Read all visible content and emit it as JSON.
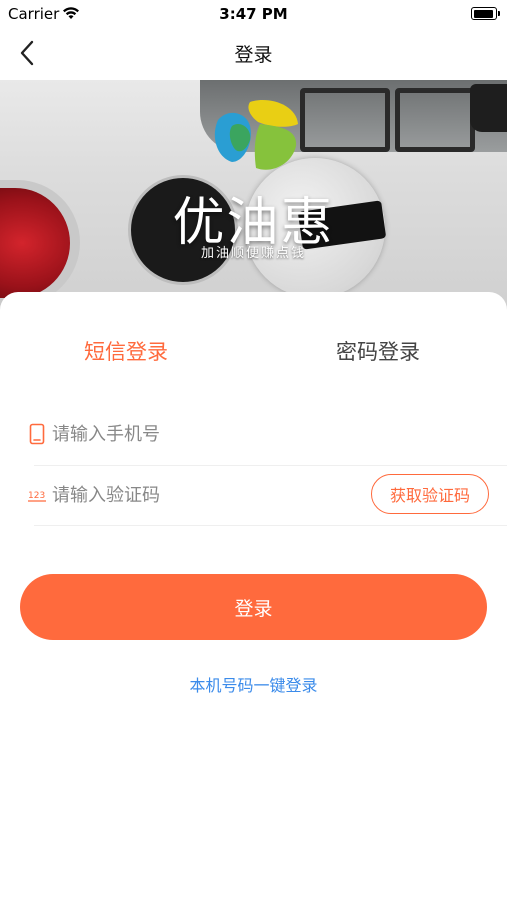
{
  "status_bar": {
    "carrier": "Carrier",
    "time": "3:47 PM"
  },
  "nav": {
    "title": "登录",
    "back_icon": "chevron-left-icon"
  },
  "banner": {
    "brand_name": "优油惠",
    "slogan": "加油顺便赚点钱",
    "logo_colors": [
      "#f2d11a",
      "#8cc63f",
      "#2aa3d8",
      "#2e7d32"
    ]
  },
  "tabs": [
    {
      "label": "短信登录",
      "active": true
    },
    {
      "label": "密码登录",
      "active": false
    }
  ],
  "form": {
    "phone": {
      "placeholder": "请输入手机号",
      "value": "",
      "icon": "phone-icon"
    },
    "code": {
      "placeholder": "请输入验证码",
      "value": "",
      "icon": "number-123-icon"
    },
    "get_code_label": "获取验证码"
  },
  "login_button_label": "登录",
  "one_click_label": "本机号码一键登录",
  "colors": {
    "accent": "#ff6a3d",
    "link": "#3b8bea"
  }
}
